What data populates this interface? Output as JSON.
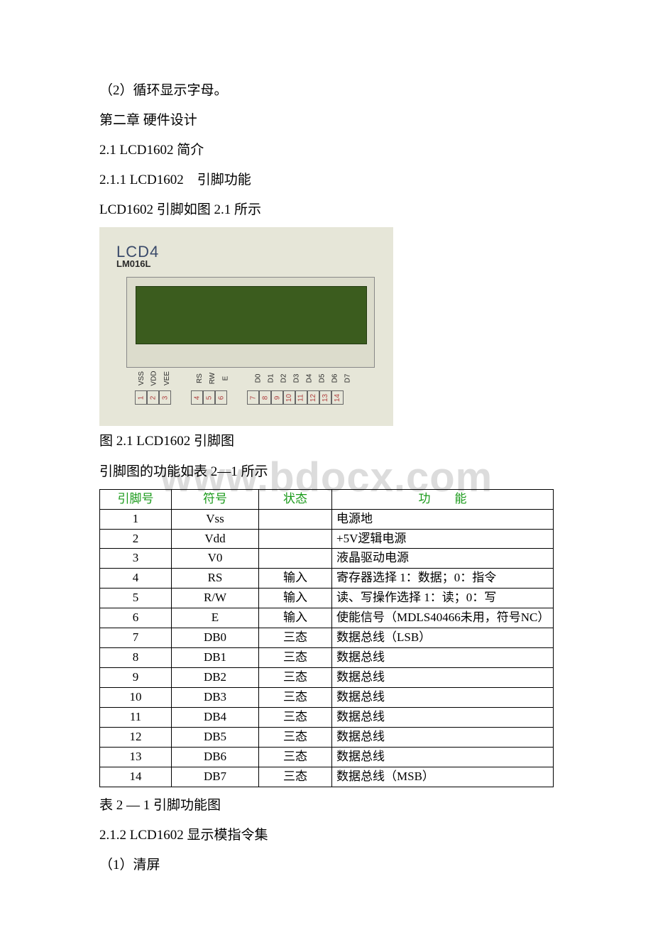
{
  "text": {
    "p1": "（2）循环显示字母。",
    "p2": "第二章 硬件设计",
    "p3": "2.1 LCD1602 简介",
    "p4": "2.1.1 LCD1602　引脚功能",
    "p5": "LCD1602 引脚如图 2.1 所示",
    "caption1": "图 2.1 LCD1602 引脚图",
    "p6": "引脚图的功能如表 2—1 所示",
    "caption2": "表 2 — 1 引脚功能图",
    "p7": "2.1.2  LCD1602 显示模指令集",
    "p8": "（1）清屏"
  },
  "watermark": "www.bdocx.com",
  "lcdFig": {
    "title": "LCD4",
    "sub": "LM016L",
    "pinLabels": [
      "VSS",
      "VDD",
      "VEE",
      "RS",
      "RW",
      "E",
      "D0",
      "D1",
      "D2",
      "D3",
      "D4",
      "D5",
      "D6",
      "D7"
    ],
    "pinNums": [
      "1",
      "2",
      "3",
      "4",
      "5",
      "6",
      "7",
      "8",
      "9",
      "10",
      "11",
      "12",
      "13",
      "14"
    ]
  },
  "table": {
    "headers": {
      "pin": "引脚号",
      "sym": "符号",
      "state": "状态",
      "func": "功　　能"
    },
    "rows": [
      {
        "pin": "1",
        "sym": "Vss",
        "state": "",
        "func": "电源地"
      },
      {
        "pin": "2",
        "sym": "Vdd",
        "state": "",
        "func": "+5V逻辑电源"
      },
      {
        "pin": "3",
        "sym": "V0",
        "state": "",
        "func": "液晶驱动电源"
      },
      {
        "pin": "4",
        "sym": "RS",
        "state": "输入",
        "func": "寄存器选择 1：数据；0：指令"
      },
      {
        "pin": "5",
        "sym": "R/W",
        "state": "输入",
        "func": "读、写操作选择 1：读；0：写"
      },
      {
        "pin": "6",
        "sym": "E",
        "state": "输入",
        "func": "使能信号（MDLS40466未用，符号NC）"
      },
      {
        "pin": "7",
        "sym": "DB0",
        "state": "三态",
        "func": "数据总线（LSB）"
      },
      {
        "pin": "8",
        "sym": "DB1",
        "state": "三态",
        "func": "数据总线"
      },
      {
        "pin": "9",
        "sym": "DB2",
        "state": "三态",
        "func": "数据总线"
      },
      {
        "pin": "10",
        "sym": "DB3",
        "state": "三态",
        "func": "数据总线"
      },
      {
        "pin": "11",
        "sym": "DB4",
        "state": "三态",
        "func": "数据总线"
      },
      {
        "pin": "12",
        "sym": "DB5",
        "state": "三态",
        "func": "数据总线"
      },
      {
        "pin": "13",
        "sym": "DB6",
        "state": "三态",
        "func": "数据总线"
      },
      {
        "pin": "14",
        "sym": "DB7",
        "state": "三态",
        "func": "数据总线（MSB）"
      }
    ]
  }
}
